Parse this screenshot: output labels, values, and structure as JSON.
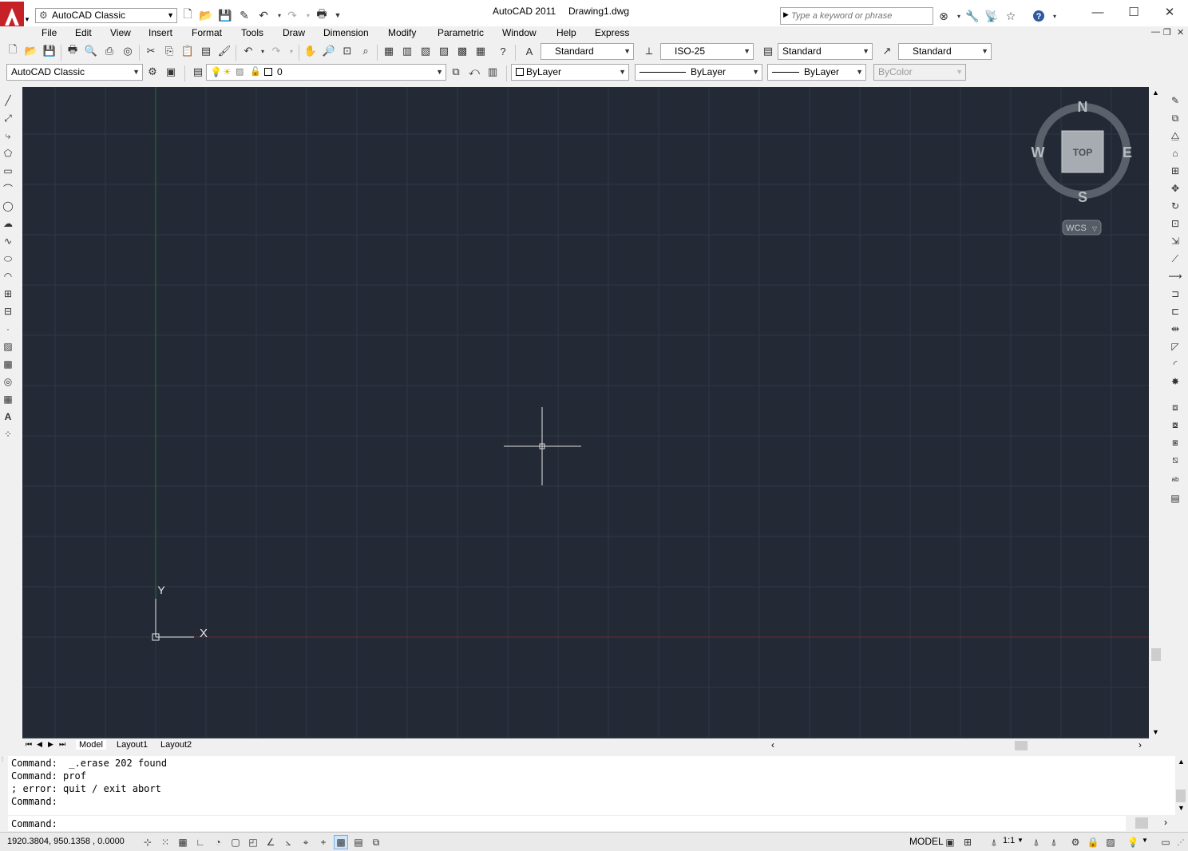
{
  "app": {
    "name": "AutoCAD 2011",
    "document": "Drawing1.dwg",
    "workspace": "AutoCAD Classic"
  },
  "search": {
    "placeholder": "Type a keyword or phrase"
  },
  "menu": [
    "File",
    "Edit",
    "View",
    "Insert",
    "Format",
    "Tools",
    "Draw",
    "Dimension",
    "Modify",
    "Parametric",
    "Window",
    "Help",
    "Express"
  ],
  "styles": {
    "text_style": "Standard",
    "dim_style": "ISO-25",
    "table_style": "Standard",
    "multileader_style": "Standard"
  },
  "layers": {
    "workspace": "AutoCAD Classic",
    "current_layer": "0",
    "color": "ByLayer",
    "linetype": "ByLayer",
    "lineweight": "ByLayer",
    "plotstyle": "ByColor"
  },
  "viewcube": {
    "north": "N",
    "south": "S",
    "east": "E",
    "west": "W",
    "face": "TOP",
    "ucs": "WCS"
  },
  "ucs_icon": {
    "y": "Y",
    "x": "X"
  },
  "tabs": [
    "Model",
    "Layout1",
    "Layout2"
  ],
  "command_history": [
    "Command:  _.erase 202 found",
    "Command: prof",
    "; error: quit / exit abort",
    "Command:"
  ],
  "command_prompt": "Command:",
  "status": {
    "coordinates": "1920.3804, 950.1358 , 0.0000",
    "space": "MODEL",
    "annotation_scale": "1:1"
  },
  "colors": {
    "canvas": "#232a36",
    "grid": "#2f3845",
    "x_axis": "#6e2a2a",
    "y_axis": "#2a6e2e"
  }
}
